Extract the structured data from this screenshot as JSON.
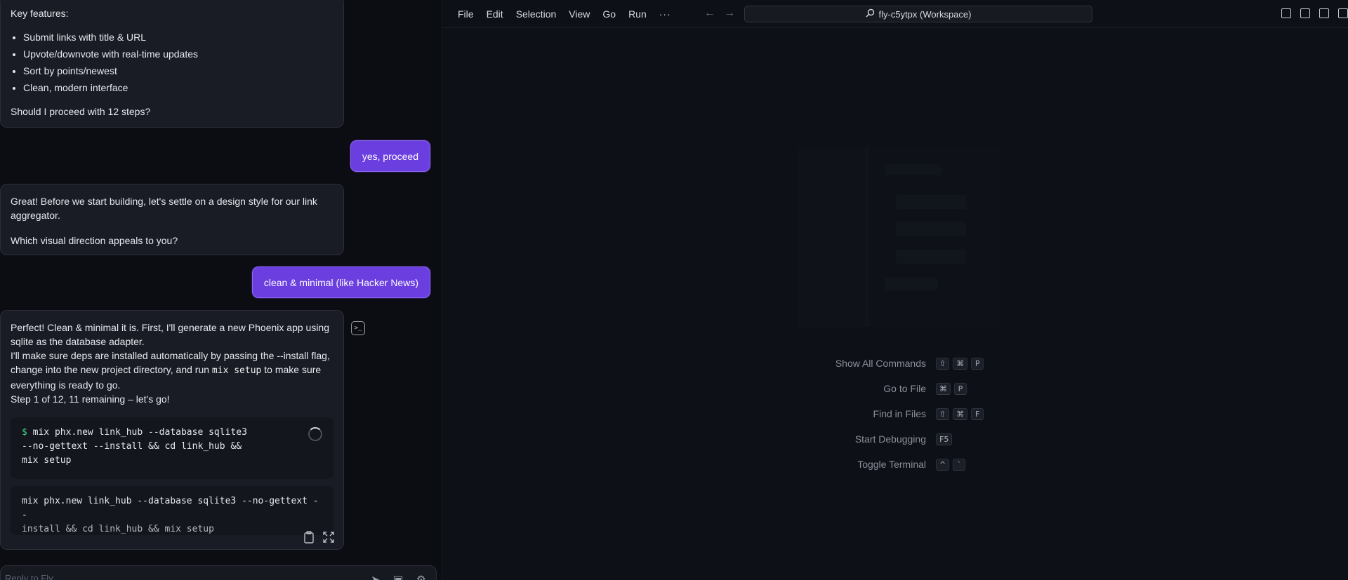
{
  "chat": {
    "msg1": {
      "heading": "Key features:",
      "features": [
        "Submit links with title & URL",
        "Upvote/downvote with real-time updates",
        "Sort by points/newest",
        "Clean, modern interface"
      ],
      "question": "Should I proceed with 12 steps?"
    },
    "user1": "yes, proceed",
    "msg2": {
      "p1": "Great! Before we start building, let's settle on a design style for our link aggregator.",
      "p2": "Which visual direction appeals to you?"
    },
    "user2": "clean & minimal (like Hacker News)",
    "msg3": {
      "line1": "Perfect! Clean & minimal it is. First, I'll generate a new Phoenix app using sqlite as the database adapter.",
      "line2a": "I'll make sure deps are installed automatically by passing the --install flag, change into the new project directory, and run ",
      "line2code": "mix setup",
      "line2b": " to make sure everything is ready to go.",
      "line3": "Step 1 of 12, 11 remaining – let's go!",
      "cmd_prompt": "$",
      "cmd_line1": "mix phx.new link_hub --database sqlite3",
      "cmd_line2": "--no-gettext --install && cd link_hub &&",
      "cmd_line3": "mix setup",
      "cmd_echo1": "mix phx.new link_hub --database sqlite3 --no-gettext --",
      "cmd_echo2": "install && cd link_hub && mix setup"
    },
    "input_placeholder": "Reply to Fly..."
  },
  "editor": {
    "menu": [
      "File",
      "Edit",
      "Selection",
      "View",
      "Go",
      "Run"
    ],
    "more": "···",
    "search_text": "fly-c5ytpx (Workspace)",
    "shortcuts": [
      {
        "label": "Show All Commands",
        "keys": [
          "⇧",
          "⌘",
          "P"
        ]
      },
      {
        "label": "Go to File",
        "keys": [
          "⌘",
          "P"
        ]
      },
      {
        "label": "Find in Files",
        "keys": [
          "⇧",
          "⌘",
          "F"
        ]
      },
      {
        "label": "Start Debugging",
        "keys": [
          "F5"
        ]
      },
      {
        "label": "Toggle Terminal",
        "keys": [
          "^",
          "`"
        ]
      }
    ]
  },
  "colors": {
    "user_bubble": "#6b3ee0",
    "ai_bubble": "#191c24",
    "prompt_green": "#3fcf8e"
  }
}
